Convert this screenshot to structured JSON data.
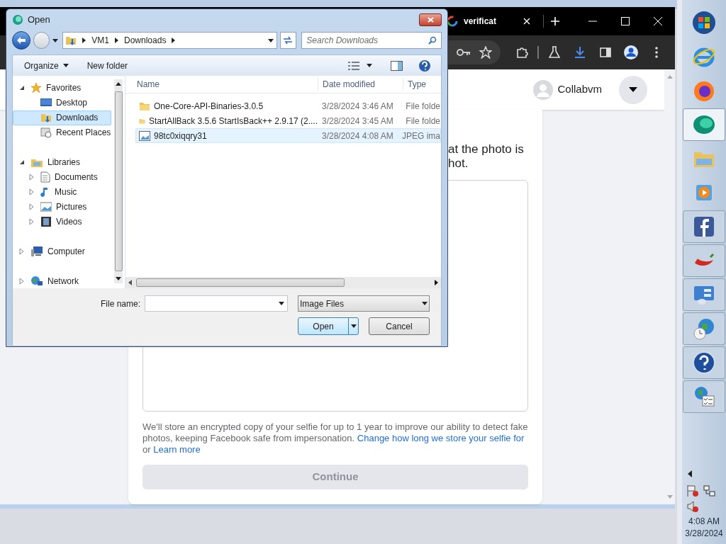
{
  "browser": {
    "tab": {
      "title": "verificat"
    },
    "page": {
      "account": "Collabvm",
      "prompt_lines": [
        "at the photo is",
        "hot."
      ],
      "notice": {
        "text": "We'll store an encrypted copy of your selfie for up to 1 year to improve our ability to detect fake photos, keeping Facebook safe from impersonation.",
        "link": "Change how long we store your selfie for",
        "joiner": "or",
        "link_2": "Learn more"
      },
      "continue": {
        "label": "Continue",
        "disabled": true
      }
    }
  },
  "dialog": {
    "title": "Open",
    "breadcrumb": [
      "VM1",
      "Downloads"
    ],
    "search": {
      "placeholder": "Search Downloads"
    },
    "toolbar": [
      "Organize",
      "New folder"
    ],
    "nav": [
      {
        "label": "Favorites",
        "expanded": true,
        "children": [
          {
            "label": "Desktop",
            "selected": false
          },
          {
            "label": "Downloads",
            "selected": true
          },
          {
            "label": "Recent Places",
            "selected": false
          }
        ]
      },
      {
        "label": "Libraries",
        "expanded": true,
        "children": [
          {
            "label": "Documents",
            "expanded": false,
            "selected": false
          },
          {
            "label": "Music",
            "expanded": false,
            "selected": false
          },
          {
            "label": "Pictures",
            "expanded": false,
            "selected": false
          },
          {
            "label": "Videos",
            "expanded": false,
            "selected": false
          }
        ]
      },
      {
        "label": "Computer",
        "expanded": false
      },
      {
        "label": "Network",
        "expanded": false
      }
    ],
    "columns": [
      "Name",
      "Date modified",
      "Type"
    ],
    "files": [
      {
        "name": "One-Core-API-Binaries-3.0.5",
        "date": "3/28/2024 3:46 AM",
        "type": "File folde",
        "kind": "folder",
        "hovered": false
      },
      {
        "name": "StartAllBack 3.5.6 StartIsBack++ 2.9.17 (2....",
        "date": "3/28/2024 3:45 AM",
        "type": "File folde",
        "kind": "folder",
        "hovered": false
      },
      {
        "name": "98tc0xiqqry31",
        "date": "3/28/2024 4:08 AM",
        "type": "JPEG ima",
        "kind": "image",
        "hovered": true
      }
    ],
    "file_name_label": "File name:",
    "file_type": "Image Files",
    "buttons": [
      "Open",
      "Cancel"
    ]
  },
  "taskbar": {
    "apps": [
      {
        "active": false
      },
      {
        "active": false
      },
      {
        "active": false
      },
      {
        "active": true
      },
      {
        "active": false
      },
      {
        "active": false
      },
      {
        "active": false
      },
      {
        "active": false
      },
      {
        "active": false
      },
      {
        "active": false
      },
      {
        "active": false
      },
      {
        "active": false
      }
    ],
    "time": "4:08 AM",
    "date": "3/28/2024"
  }
}
